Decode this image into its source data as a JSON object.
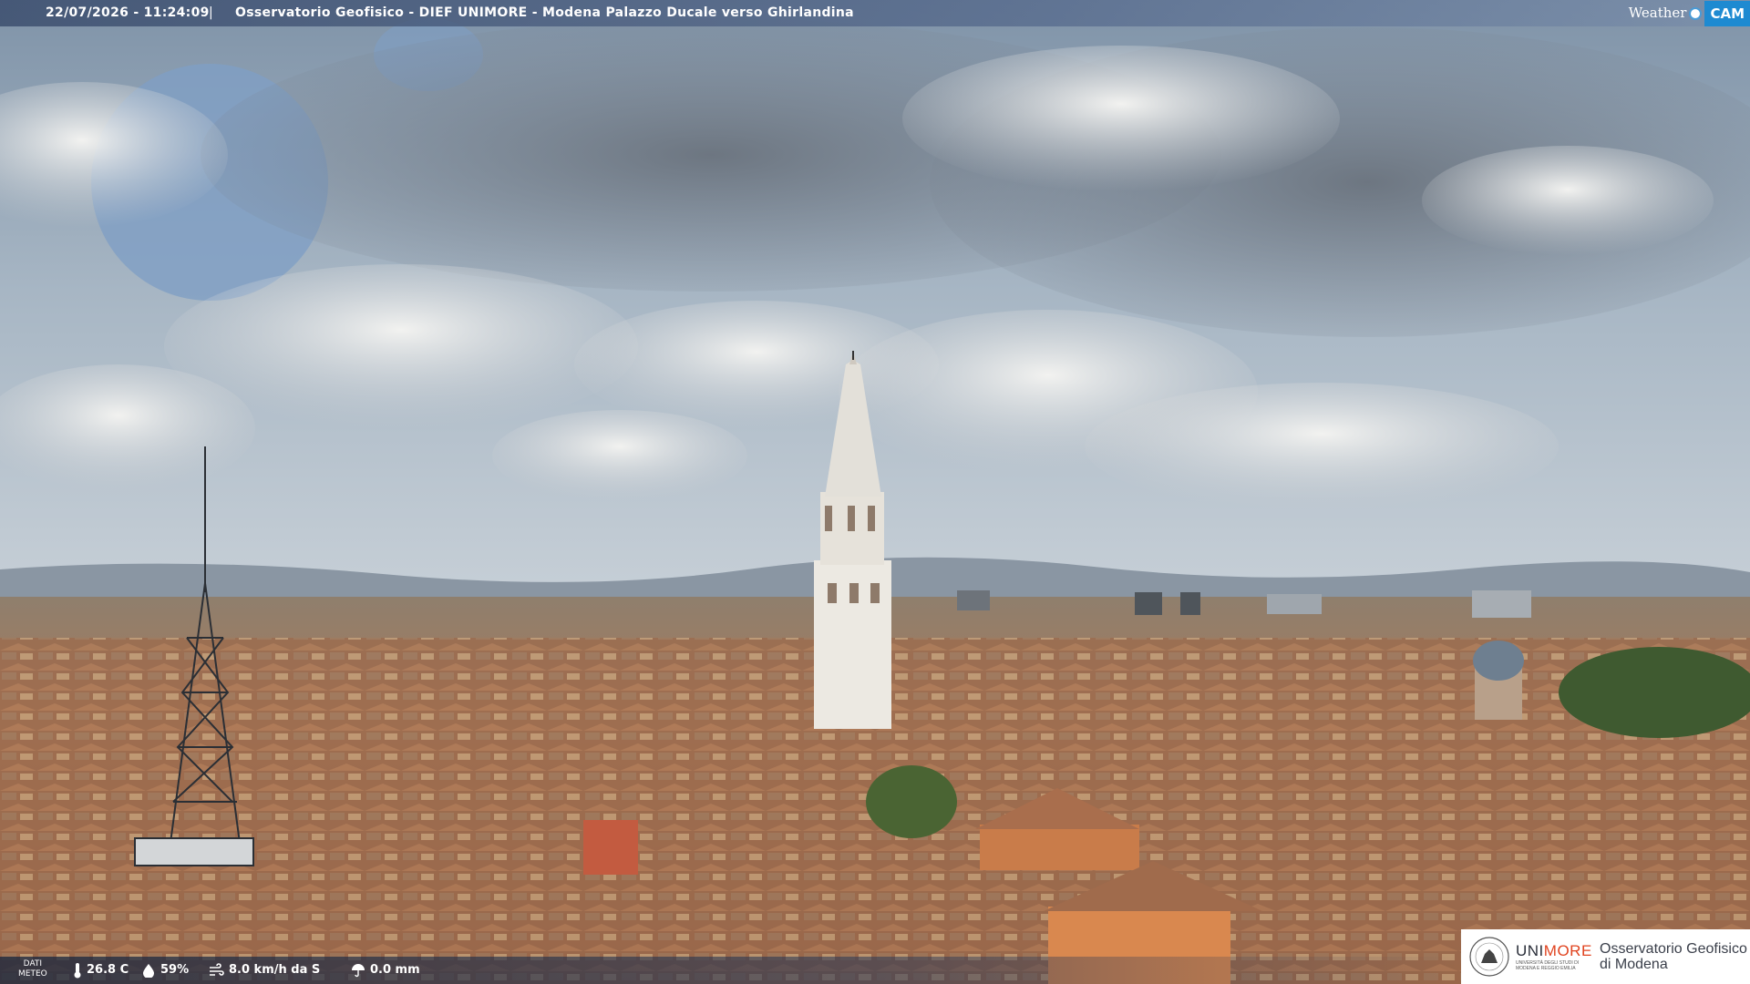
{
  "header": {
    "timestamp": "22/07/2026 - 11:24:09",
    "separator": "|",
    "title": "Osservatorio Geofisico - DIEF UNIMORE - Modena Palazzo Ducale verso Ghirlandina",
    "logo_left": "Weather",
    "logo_right": "CAM"
  },
  "weather": {
    "label_line1": "DATI",
    "label_line2": "METEO",
    "temperature": "26.8 C",
    "humidity": "59%",
    "wind": "8.0 km/h da S",
    "rain": "0.0 mm"
  },
  "footer_logo": {
    "university_name_a": "UNI",
    "university_name_b": "MORE",
    "university_sub": "UNIVERSITÀ DEGLI STUDI DI MODENA E REGGIO EMILIA",
    "observatory_line1": "Osservatorio Geofisico",
    "observatory_line2": "di Modena"
  },
  "colors": {
    "accent_blue": "#1e8ad1",
    "unimore_orange": "#e0431f"
  }
}
